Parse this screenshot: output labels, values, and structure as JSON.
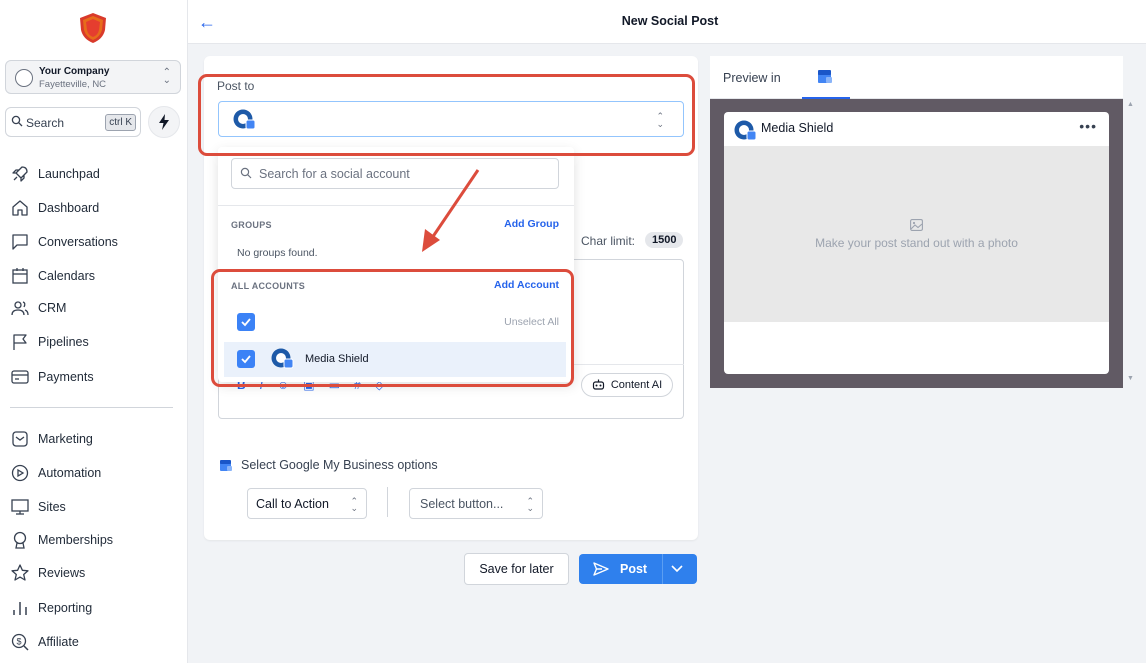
{
  "header": {
    "title": "New Social Post"
  },
  "company": {
    "name": "Your Company",
    "location": "Fayetteville, NC"
  },
  "search": {
    "label": "Search",
    "shortcut": "ctrl K"
  },
  "nav": [
    {
      "label": "Launchpad",
      "icon": "rocket-icon"
    },
    {
      "label": "Dashboard",
      "icon": "home-icon"
    },
    {
      "label": "Conversations",
      "icon": "chat-icon"
    },
    {
      "label": "Calendars",
      "icon": "calendar-icon"
    },
    {
      "label": "CRM",
      "icon": "users-icon"
    },
    {
      "label": "Pipelines",
      "icon": "flag-icon"
    },
    {
      "label": "Payments",
      "icon": "card-icon"
    },
    {
      "label": "Marketing",
      "icon": "mail-icon"
    },
    {
      "label": "Automation",
      "icon": "play-icon"
    },
    {
      "label": "Sites",
      "icon": "monitor-icon"
    },
    {
      "label": "Memberships",
      "icon": "badge-icon"
    },
    {
      "label": "Reviews",
      "icon": "star-icon"
    },
    {
      "label": "Reporting",
      "icon": "bar-chart-icon"
    },
    {
      "label": "Affiliate",
      "icon": "dollar-search-icon"
    }
  ],
  "composer": {
    "post_to_label": "Post to",
    "char_limit_label": "Char limit:",
    "char_limit_value": "1500",
    "content_ai_label": "Content AI",
    "gmb_options_label": "Select Google My Business options",
    "cta_value": "Call to Action",
    "button_placeholder": "Select button...",
    "save_later_label": "Save for later",
    "post_label": "Post"
  },
  "dropdown": {
    "search_placeholder": "Search for a social account",
    "groups_header": "GROUPS",
    "add_group_label": "Add Group",
    "no_groups_text": "No groups found.",
    "accounts_header": "ALL ACCOUNTS",
    "add_account_label": "Add Account",
    "unselect_all_label": "Unselect All",
    "account_name": "Media Shield"
  },
  "preview": {
    "preview_in_label": "Preview in",
    "account_name": "Media Shield",
    "photo_prompt": "Make your post stand out with a photo"
  },
  "colors": {
    "accent": "#2f80ed",
    "annotation": "#dc4c3c",
    "checkbox": "#3b82f6"
  }
}
